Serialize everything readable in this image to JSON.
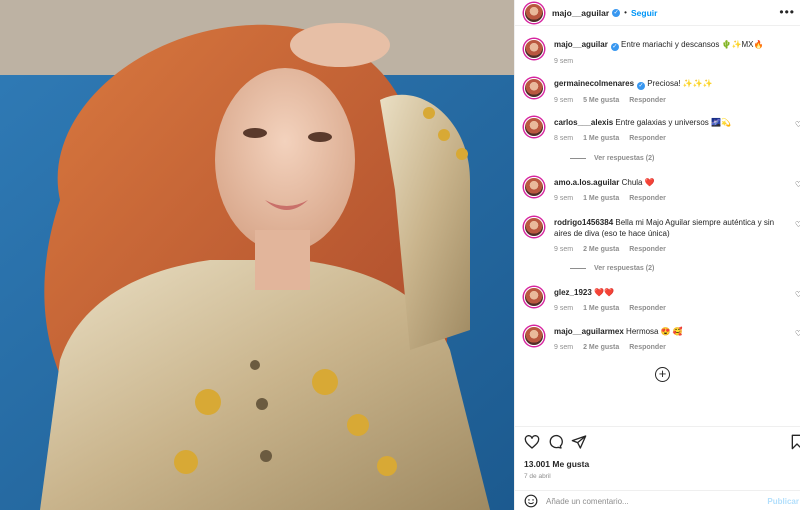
{
  "post": {
    "author": "majo__aguilar",
    "verified": true,
    "follow_label": "Seguir",
    "more_label": "•••",
    "caption": {
      "user": "majo__aguilar",
      "text": "Entre mariachi y descansos 🌵✨MX🔥",
      "time": "9 sem"
    }
  },
  "comments": [
    {
      "user": "germainecolmenares",
      "verified": true,
      "text": "Preciosa! ✨✨✨",
      "time": "9 sem",
      "likes": "5 Me gusta",
      "reply": "Responder"
    },
    {
      "user": "carlos___alexis",
      "verified": false,
      "text": "Entre galaxias y universos 🌌💫",
      "time": "8 sem",
      "likes": "1 Me gusta",
      "reply": "Responder",
      "replies_label": "Ver respuestas (2)"
    },
    {
      "user": "amo.a.los.aguilar",
      "verified": false,
      "text": "Chula ❤️",
      "time": "9 sem",
      "likes": "1 Me gusta",
      "reply": "Responder"
    },
    {
      "user": "rodrigo1456384",
      "verified": false,
      "text": "Bella mi Majo Aguilar siempre auténtica y sin aires de diva (eso te hace única)",
      "time": "9 sem",
      "likes": "2 Me gusta",
      "reply": "Responder",
      "replies_label": "Ver respuestas (2)"
    },
    {
      "user": "glez_1923",
      "verified": false,
      "text": "❤️❤️",
      "time": "9 sem",
      "likes": "1 Me gusta",
      "reply": "Responder"
    },
    {
      "user": "majo__aguilarmex",
      "verified": false,
      "text": "Hermosa 😍 🥰",
      "time": "9 sem",
      "likes": "2 Me gusta",
      "reply": "Responder"
    }
  ],
  "actions": {
    "likes_count": "13.001 Me gusta",
    "date": "7 de abril",
    "comment_placeholder": "Añade un comentario...",
    "publish_label": "Publicar"
  },
  "icons": [
    "heart-icon",
    "comment-icon",
    "share-icon",
    "bookmark-icon",
    "emoji-icon",
    "add-circle-icon",
    "more-icon",
    "verified-icon"
  ],
  "colors": {
    "accent": "#0095f6",
    "verified": "#3897f0",
    "text": "#262626",
    "muted": "#8e8e8e"
  }
}
